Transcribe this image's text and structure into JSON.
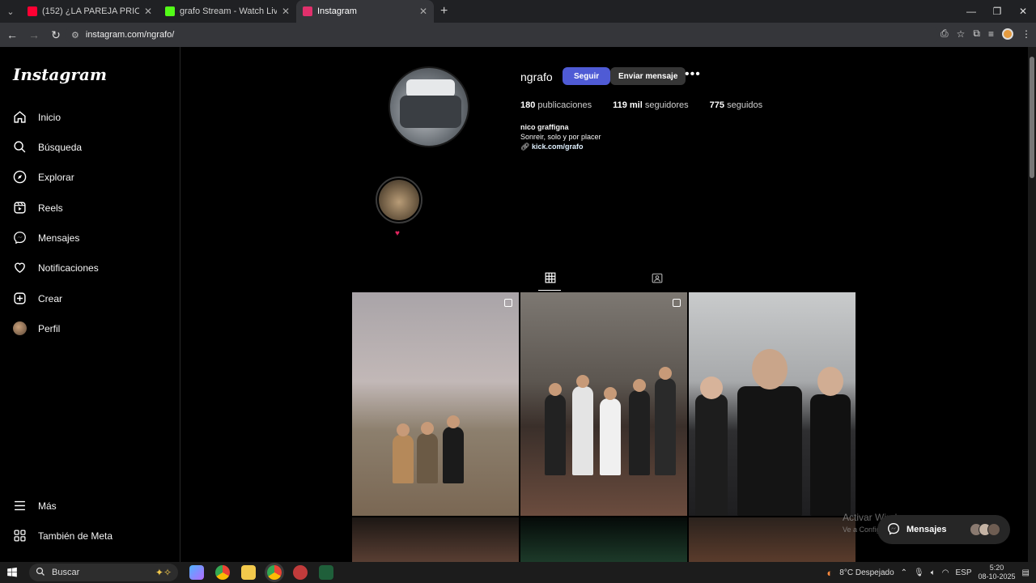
{
  "browser": {
    "tabs": [
      {
        "label": "(152) ¿LA PAREJA PRIORIDAD",
        "favicon_color": "#ff0033"
      },
      {
        "label": "grafo Stream - Watch Live o",
        "favicon_color": "#53fc18"
      },
      {
        "label": "Instagram",
        "favicon_color": "#e1306c",
        "active": true
      }
    ],
    "url": "instagram.com/ngrafo/"
  },
  "sidebar": {
    "logo": "Instagram",
    "items": [
      {
        "label": "Inicio",
        "icon": "home-icon"
      },
      {
        "label": "Búsqueda",
        "icon": "search-icon"
      },
      {
        "label": "Explorar",
        "icon": "compass-icon"
      },
      {
        "label": "Reels",
        "icon": "reels-icon"
      },
      {
        "label": "Mensajes",
        "icon": "messenger-icon"
      },
      {
        "label": "Notificaciones",
        "icon": "heart-icon"
      },
      {
        "label": "Crear",
        "icon": "plus-square-icon"
      },
      {
        "label": "Perfil",
        "icon": "profile-avatar"
      }
    ],
    "bottom": [
      {
        "label": "Más",
        "icon": "menu-icon"
      },
      {
        "label": "También de Meta",
        "icon": "meta-icon"
      }
    ]
  },
  "profile": {
    "username": "ngrafo",
    "follow_label": "Seguir",
    "message_label": "Enviar mensaje",
    "stats": {
      "posts": "180",
      "posts_label": "publicaciones",
      "followers": "119 mil",
      "followers_label": "seguidores",
      "following": "775",
      "following_label": "seguidos"
    },
    "full_name": "nico graffigna",
    "bio": "Sonreir, solo y por placer",
    "link": "kick.com/grafo",
    "highlight_label": "♥"
  },
  "chat": {
    "label": "Mensajes"
  },
  "watermark": {
    "line1": "Activar Windows",
    "line2": "Ve a Configuración para activar Windows."
  },
  "taskbar": {
    "search_placeholder": "Buscar",
    "weather": "8°C  Despejado",
    "lang": "ESP",
    "time": "5:20",
    "date": "08-10-2025"
  },
  "colors": {
    "accent": "#4f5bd5",
    "background": "#000000"
  }
}
